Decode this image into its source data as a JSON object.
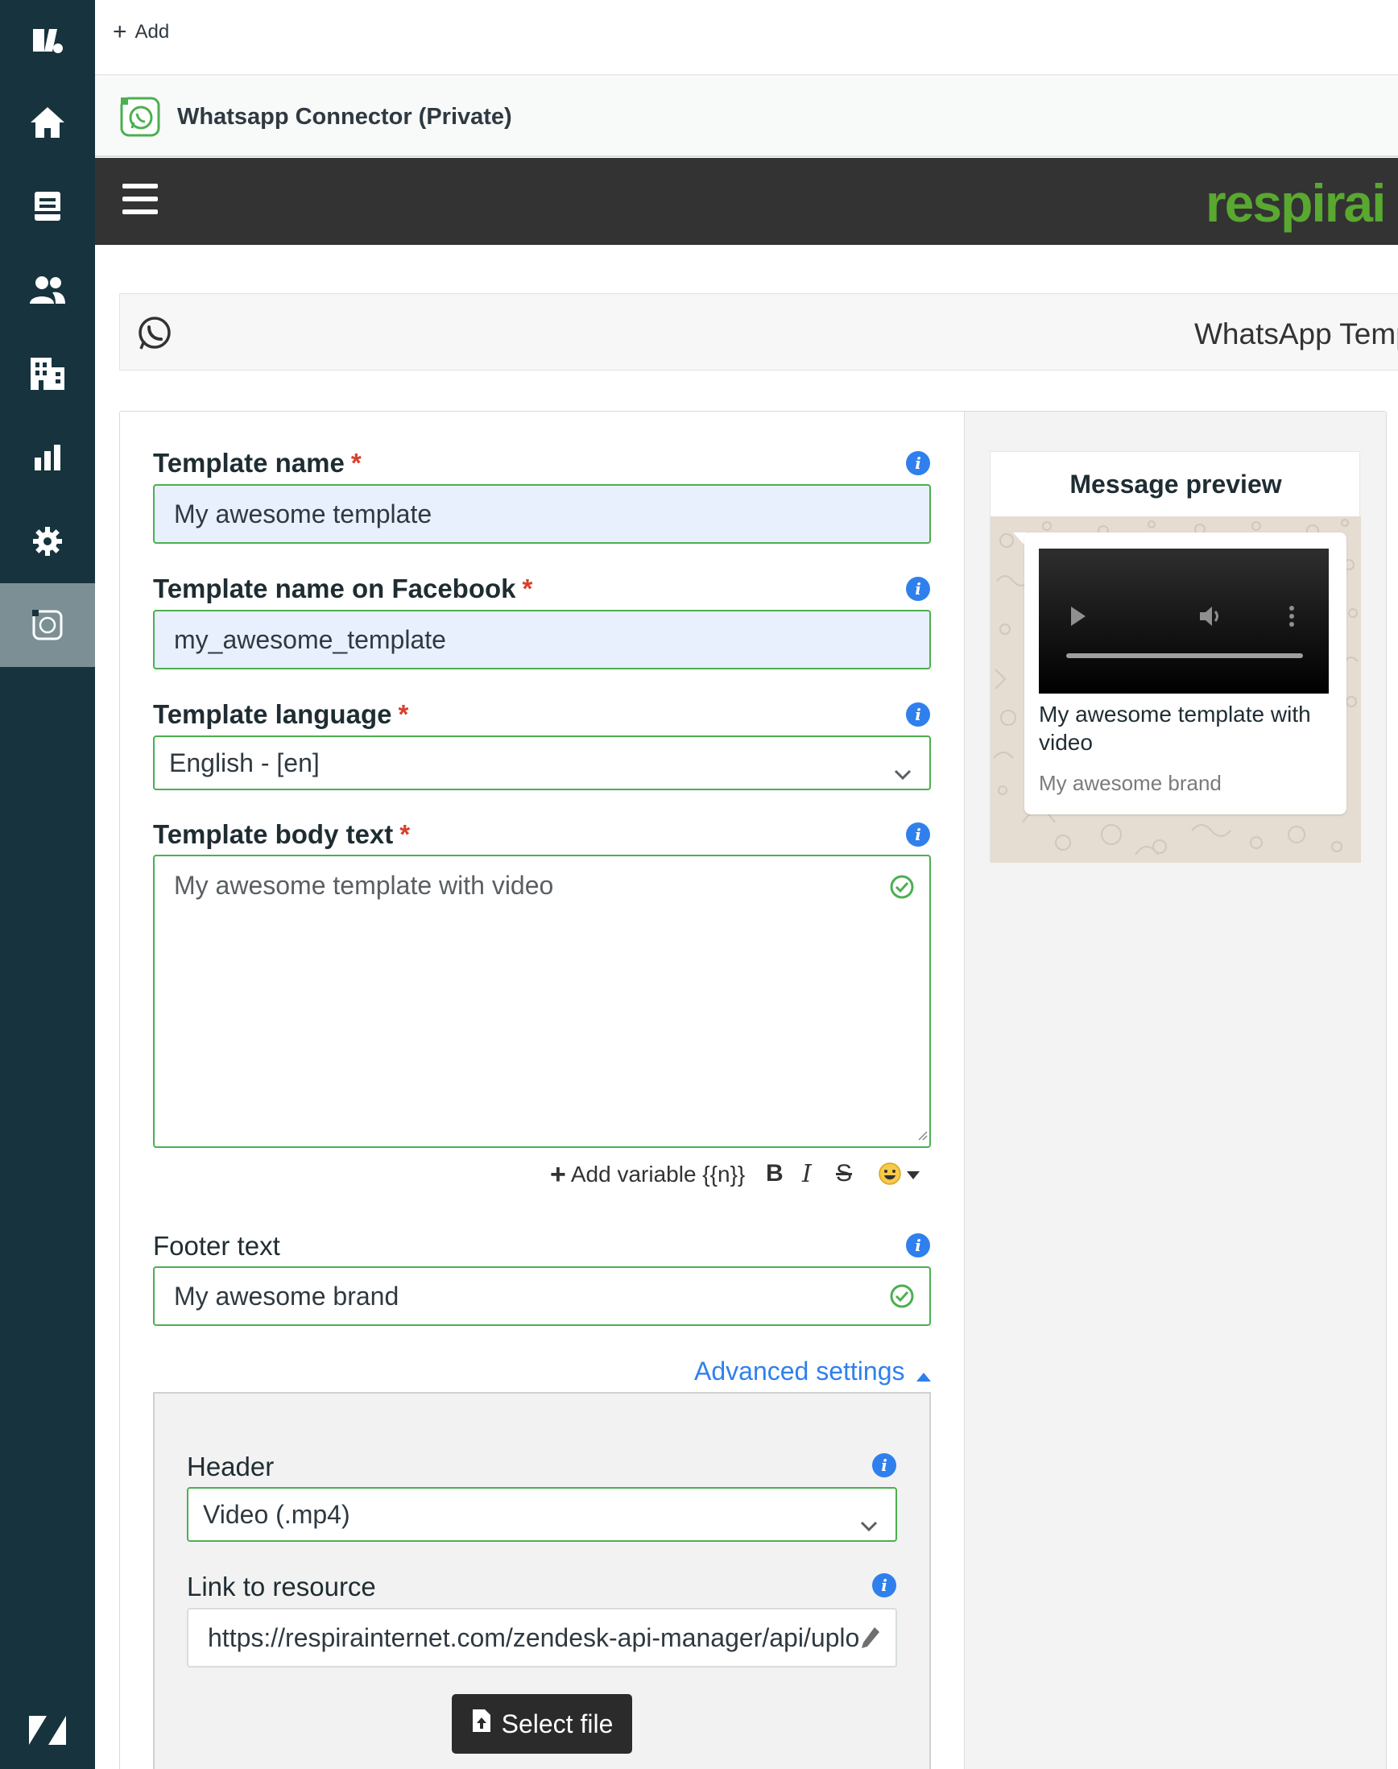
{
  "topbar": {
    "add_label": "Add"
  },
  "app_header": {
    "title": "Whatsapp Connector (Private)"
  },
  "banner": {
    "brand_visible": "respirai",
    "brand_cut": "i"
  },
  "page": {
    "title": "WhatsApp Temp"
  },
  "form": {
    "template_name": {
      "label": "Template name",
      "required_mark": "*",
      "value": "My awesome template"
    },
    "template_name_facebook": {
      "label": "Template name on Facebook",
      "required_mark": "*",
      "value": "my_awesome_template"
    },
    "template_language": {
      "label": "Template language",
      "required_mark": "*",
      "value": "English - [en]"
    },
    "template_body": {
      "label": "Template body text",
      "required_mark": "*",
      "value": "My awesome template with video"
    },
    "body_toolbar": {
      "add_variable": "Add variable {{n}}",
      "bold": "B",
      "italic": "I",
      "strike": "S"
    },
    "footer": {
      "label": "Footer text",
      "value": "My awesome brand"
    },
    "advanced_settings_label": "Advanced settings",
    "advanced": {
      "header": {
        "label": "Header",
        "value": "Video (.mp4)"
      },
      "link": {
        "label": "Link to resource",
        "value": "https://respirainternet.com/zendesk-api-manager/api/uplo"
      },
      "select_file_label": "Select file"
    }
  },
  "preview": {
    "heading": "Message preview",
    "body": "My awesome template with video",
    "footer": "My awesome brand"
  },
  "colors": {
    "sidebar": "#17333e",
    "accent_green": "#4caf50",
    "info_blue": "#2f80ed",
    "brand_green": "#59a830",
    "required_red": "#d93f2c"
  }
}
